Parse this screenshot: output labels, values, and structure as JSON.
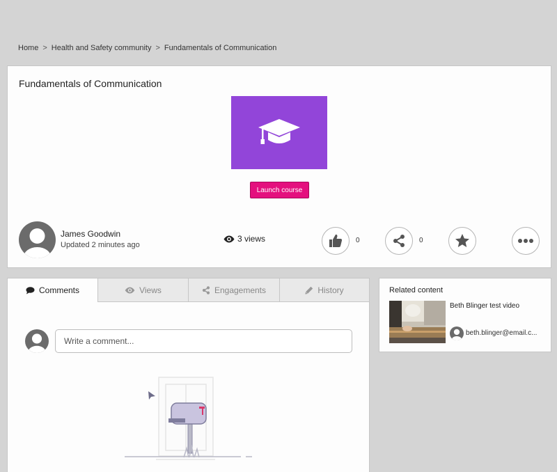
{
  "breadcrumb": {
    "home": "Home",
    "community": "Health and Safety community",
    "current": "Fundamentals of Communication",
    "separator": ">"
  },
  "course": {
    "title": "Fundamentals of Communication",
    "thumbnail_icon": "graduation-cap-icon",
    "thumbnail_color": "#9245d9",
    "launch_label": "Launch course",
    "launch_color": "#e4107e"
  },
  "author": {
    "name": "James Goodwin",
    "updated": "Updated 2 minutes ago"
  },
  "stats": {
    "views": "3 views",
    "likes": "0",
    "shares": "0"
  },
  "tabs": [
    {
      "label": "Comments",
      "icon": "comment-icon"
    },
    {
      "label": "Views",
      "icon": "eye-icon"
    },
    {
      "label": "Engagements",
      "icon": "share-icon"
    },
    {
      "label": "History",
      "icon": "pencil-icon"
    }
  ],
  "comment": {
    "placeholder": "Write a comment..."
  },
  "related": {
    "title": "Related content",
    "items": [
      {
        "title": "Beth Blinger test video",
        "author": "beth.blinger@email.c..."
      }
    ]
  }
}
